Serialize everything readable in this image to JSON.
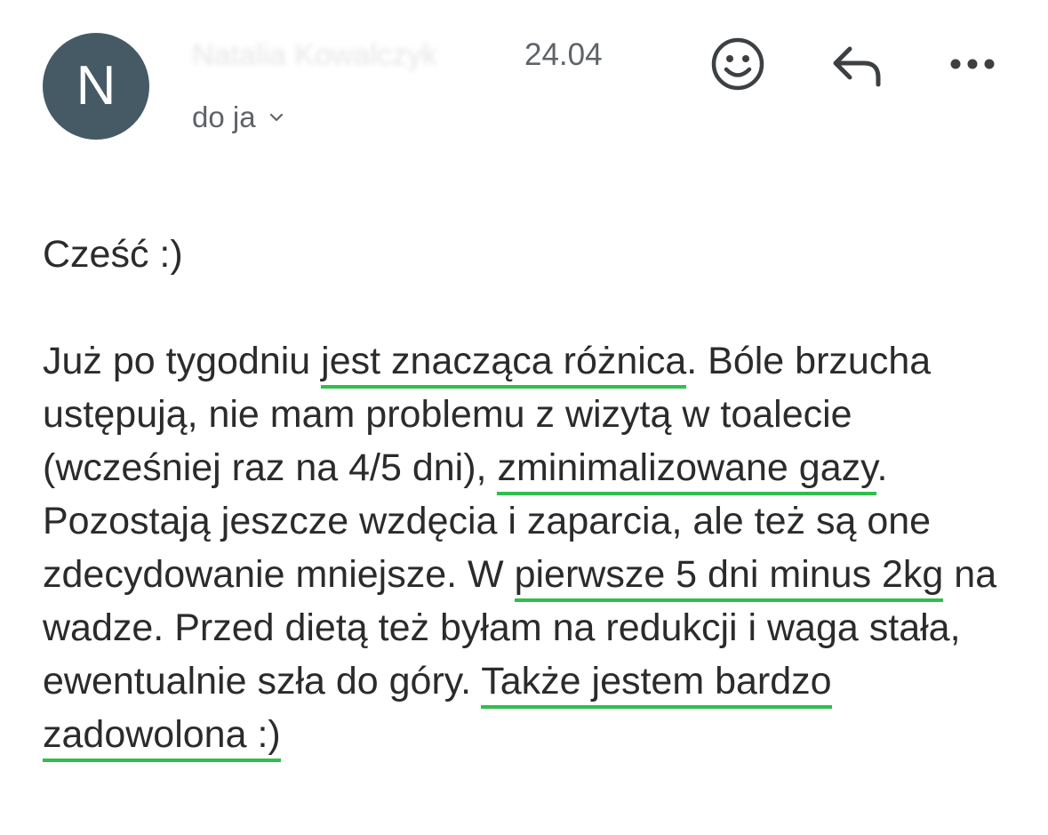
{
  "header": {
    "avatar_letter": "N",
    "sender_name": "Natalia Kowalczyk",
    "date": "24.04",
    "recipient_label": "do ja"
  },
  "icons": {
    "emoji": "smiley-face-icon",
    "reply": "reply-arrow-icon",
    "more": "more-horizontal-icon",
    "chevron": "chevron-down-icon"
  },
  "colors": {
    "avatar_bg": "#455a64",
    "highlight_underline": "#2fbf4c",
    "text": "#2b2b2b",
    "muted": "#5f6368"
  },
  "message": {
    "greeting": "Cześć :)",
    "segments": [
      {
        "text": "Już po tygodniu ",
        "highlight": false
      },
      {
        "text": "jest znacząca różnica",
        "highlight": true
      },
      {
        "text": ". Bóle brzucha ustępują, nie mam problemu z wizytą w toalecie (wcześniej raz na 4/5 dni), ",
        "highlight": false
      },
      {
        "text": "zminimalizowane gazy",
        "highlight": true
      },
      {
        "text": ". Pozostają jeszcze wzdęcia i zaparcia, ale też są one zdecydowanie mniejsze. W ",
        "highlight": false
      },
      {
        "text": "pierwsze 5 dni minus 2kg",
        "highlight": true
      },
      {
        "text": " na wadze. Przed dietą też byłam na redukcji i waga stała, ewentualnie szła do góry. ",
        "highlight": false
      },
      {
        "text": "Także jestem bardzo zadowolona :)",
        "highlight": true
      }
    ]
  }
}
